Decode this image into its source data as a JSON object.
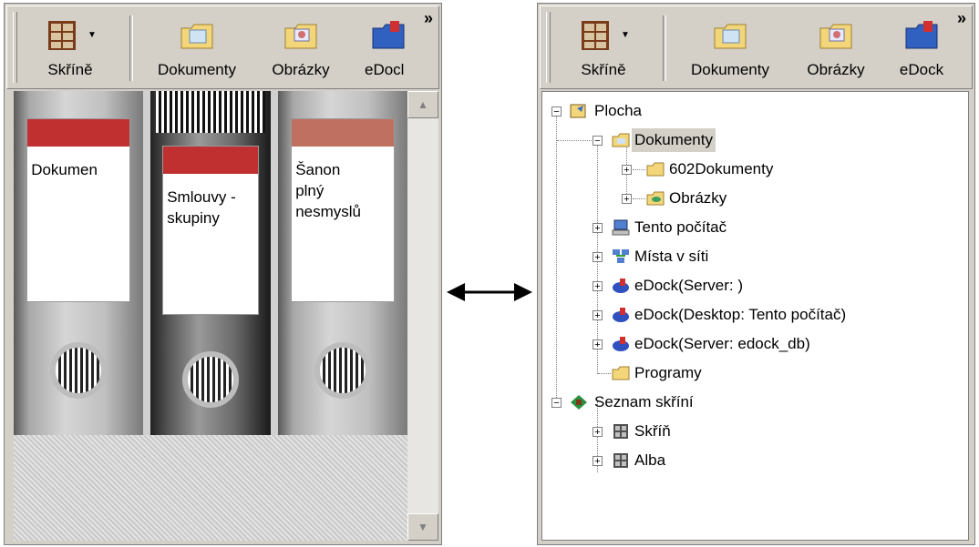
{
  "toolbar": {
    "cabinet_label": "Skříně",
    "documents_label": "Dokumenty",
    "pictures_label": "Obrázky",
    "edock_label_left": "eDocl",
    "edock_label_right": "eDock",
    "more_glyph": "»"
  },
  "binders": [
    {
      "label": "Dokumen"
    },
    {
      "label_line1": "Smlouvy -",
      "label_line2": "skupiny"
    },
    {
      "label_line1": "Šanon",
      "label_line2": "plný",
      "label_line3": "nesmyslů"
    }
  ],
  "tree": {
    "desktop": "Plocha",
    "documents": "Dokumenty",
    "docs602": "602Dokumenty",
    "pictures": "Obrázky",
    "this_pc": "Tento počítač",
    "network": "Místa v síti",
    "edock_server": "eDock(Server: )",
    "edock_desktop": "eDock(Desktop: Tento počítač)",
    "edock_db": "eDock(Server: edock_db)",
    "programs": "Programy",
    "cabinet_list": "Seznam skříní",
    "cabinet_skrin": "Skříň",
    "cabinet_alba": "Alba"
  },
  "colors": {
    "panel_bg": "#d4d0c8",
    "label_stripe": "#c03030",
    "selection": "#d4d0c8"
  }
}
